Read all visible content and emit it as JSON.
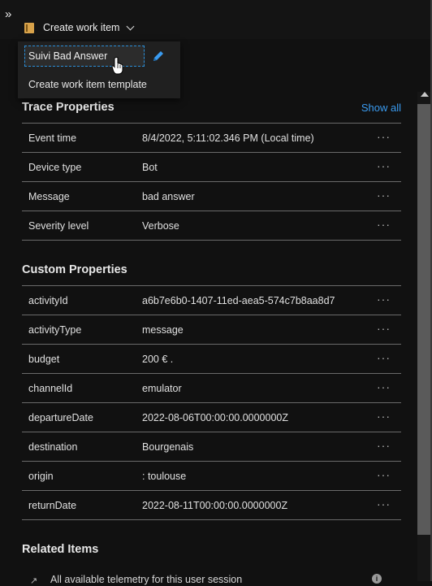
{
  "header": {
    "expand_glyph": "»",
    "create_work_item_label": "Create work item",
    "book_icon": "book-icon",
    "chevron_icon": "chevron-down-icon"
  },
  "dropdown": {
    "items": [
      {
        "label": "Suivi Bad Answer"
      },
      {
        "label": "Create work item template"
      }
    ],
    "edit_icon": "pencil-icon",
    "cursor_icon": "hand-pointer-icon"
  },
  "trace": {
    "title": "Trace Properties",
    "show_all": "Show all",
    "rows": [
      {
        "key": "Event time",
        "value": "8/4/2022, 5:11:02.346 PM (Local time)"
      },
      {
        "key": "Device type",
        "value": "Bot"
      },
      {
        "key": "Message",
        "value": "bad answer"
      },
      {
        "key": "Severity level",
        "value": "Verbose"
      }
    ]
  },
  "custom": {
    "title": "Custom Properties",
    "rows": [
      {
        "key": "activityId",
        "value": "a6b7e6b0-1407-11ed-aea5-574c7b8aa8d7"
      },
      {
        "key": "activityType",
        "value": "message"
      },
      {
        "key": "budget",
        "value": "200 € ."
      },
      {
        "key": "channelId",
        "value": "emulator"
      },
      {
        "key": "departureDate",
        "value": "2022-08-06T00:00:00.0000000Z"
      },
      {
        "key": "destination",
        "value": "Bourgenais"
      },
      {
        "key": "origin",
        "value": ": toulouse"
      },
      {
        "key": "returnDate",
        "value": "2022-08-11T00:00:00.0000000Z"
      }
    ]
  },
  "more_glyph": "···",
  "related": {
    "title": "Related Items",
    "first_item": "All available telemetry for this user session",
    "info_glyph": "i"
  },
  "colors": {
    "background": "#111111",
    "accent_link": "#3a9bf0",
    "divider": "#6a6a6a",
    "selection_border": "#2b8fd8"
  }
}
